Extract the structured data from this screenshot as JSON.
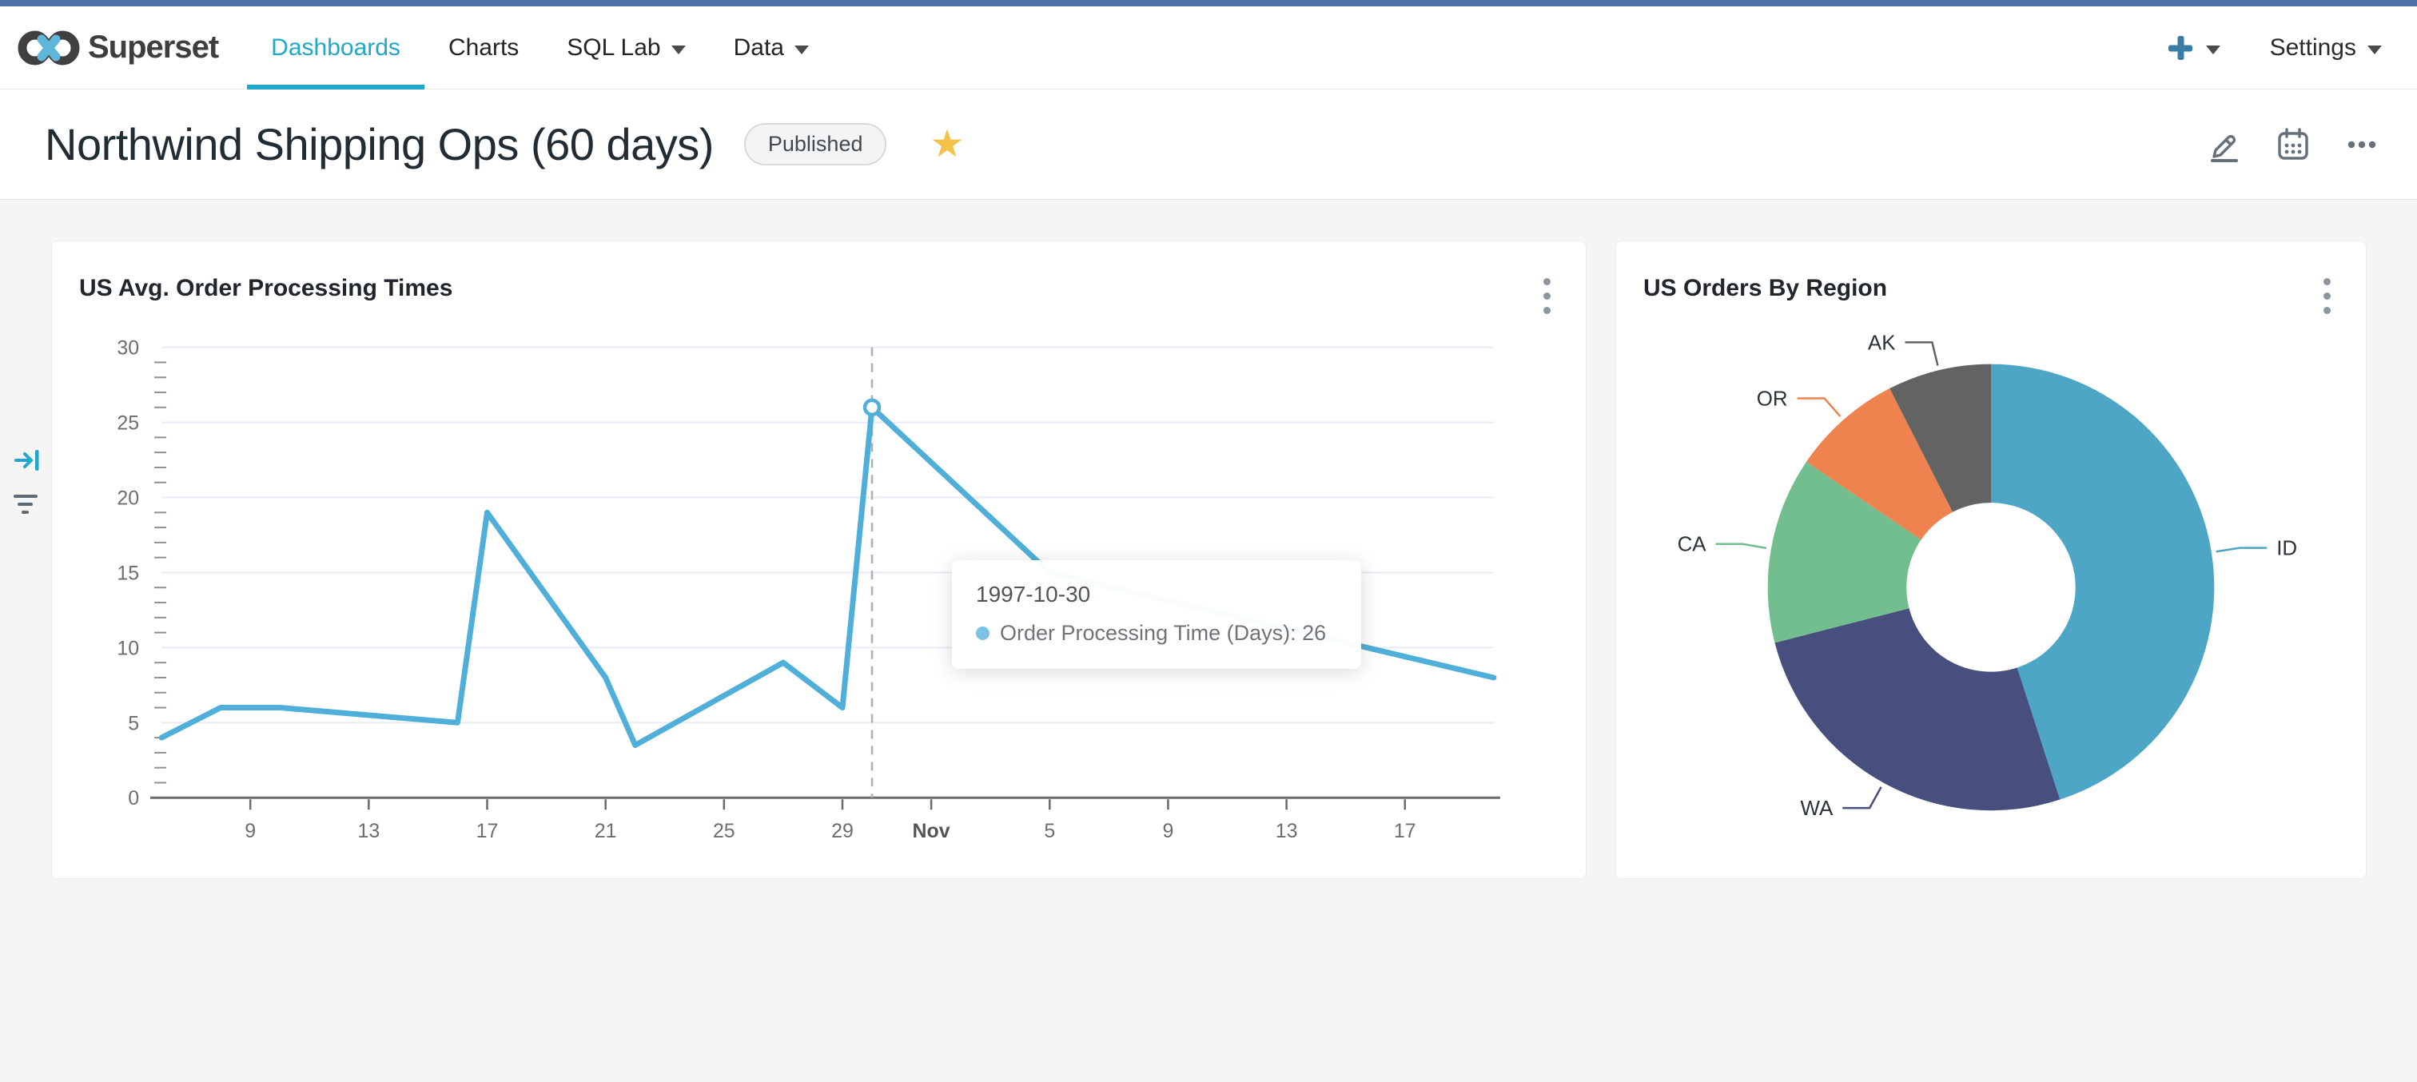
{
  "nav": {
    "brand": "Superset",
    "tabs": [
      {
        "label": "Dashboards",
        "active": true,
        "has_caret": false
      },
      {
        "label": "Charts",
        "active": false,
        "has_caret": false
      },
      {
        "label": "SQL Lab",
        "active": false,
        "has_caret": true
      },
      {
        "label": "Data",
        "active": false,
        "has_caret": true
      }
    ],
    "settings_label": "Settings"
  },
  "header": {
    "title": "Northwind Shipping Ops (60 days)",
    "badge": "Published"
  },
  "colors": {
    "accent": "#20A7C9",
    "top_strip": "#4E73A9",
    "line": "#4FAFD9",
    "star": "#F2C24B",
    "page_bg": "#F5F5F5"
  },
  "tooltip": {
    "date": "1997-10-30",
    "text": "Order Processing Time (Days): 26"
  },
  "chart_data": [
    {
      "type": "line",
      "title": "US Avg. Order Processing Times",
      "line_color": "#4FAFD9",
      "ylim": [
        0,
        30
      ],
      "yticks": [
        0,
        5,
        10,
        15,
        20,
        25,
        30
      ],
      "x_range": [
        "1997-10-06",
        "1997-11-20"
      ],
      "xticks": [
        {
          "date": "1997-10-09",
          "label": "9"
        },
        {
          "date": "1997-10-13",
          "label": "13"
        },
        {
          "date": "1997-10-17",
          "label": "17"
        },
        {
          "date": "1997-10-21",
          "label": "21"
        },
        {
          "date": "1997-10-25",
          "label": "25"
        },
        {
          "date": "1997-10-29",
          "label": "29"
        },
        {
          "date": "1997-11-01",
          "label": "Nov",
          "bold": true
        },
        {
          "date": "1997-11-05",
          "label": "5"
        },
        {
          "date": "1997-11-09",
          "label": "9"
        },
        {
          "date": "1997-11-13",
          "label": "13"
        },
        {
          "date": "1997-11-17",
          "label": "17"
        }
      ],
      "series": [
        {
          "name": "Order Processing Time (Days)",
          "points": [
            [
              "1997-10-06",
              4
            ],
            [
              "1997-10-08",
              6
            ],
            [
              "1997-10-10",
              6
            ],
            [
              "1997-10-16",
              5
            ],
            [
              "1997-10-17",
              19
            ],
            [
              "1997-10-21",
              8
            ],
            [
              "1997-10-22",
              3.5
            ],
            [
              "1997-10-27",
              9
            ],
            [
              "1997-10-29",
              6
            ],
            [
              "1997-10-30",
              26
            ],
            [
              "1997-11-05",
              15
            ],
            [
              "1997-11-20",
              8
            ]
          ]
        }
      ],
      "highlight": {
        "date": "1997-10-30",
        "value": 26
      },
      "grid": true,
      "legend": "none"
    },
    {
      "type": "pie",
      "title": "US Orders By Region",
      "donut": true,
      "labels": [
        "ID",
        "WA",
        "CA",
        "OR",
        "AK"
      ],
      "values": [
        45,
        26,
        13.5,
        8,
        7.5
      ],
      "colors": [
        "#4DA6C6",
        "#474F7E",
        "#73BE8E",
        "#EE8350",
        "#636363"
      ],
      "start_angle_deg": 0,
      "legend": "labels-with-leader-lines"
    }
  ]
}
